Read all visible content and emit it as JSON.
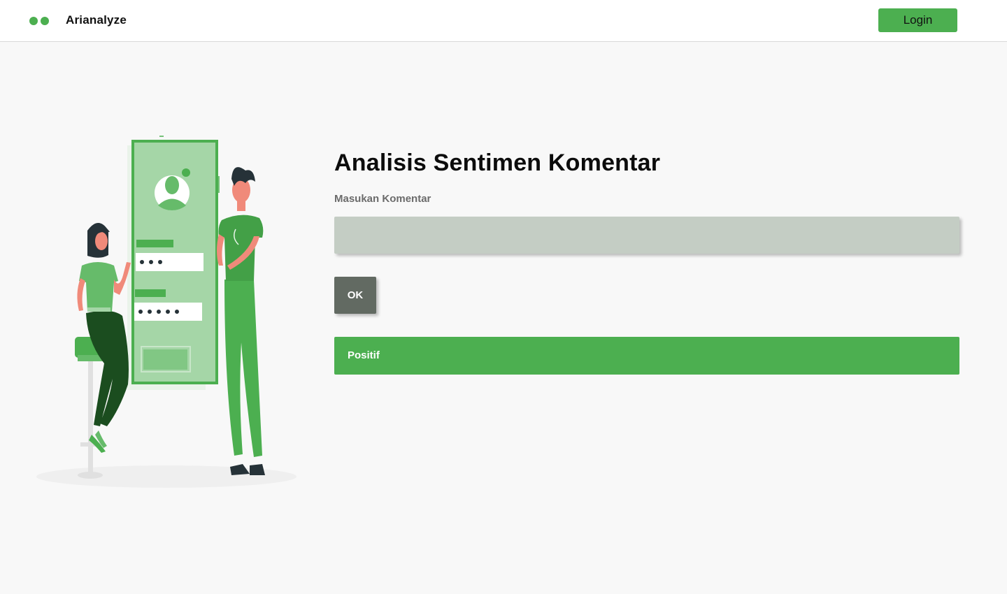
{
  "navbar": {
    "brand": "Arianalyze",
    "login_label": "Login",
    "logo_icon": "two-dots-logo-icon",
    "accent_color": "#4caf50"
  },
  "illustration": {
    "name": "people-with-login-screen-illustration"
  },
  "main": {
    "title": "Analisis Sentimen Komentar",
    "input_label": "Masukan Komentar",
    "input_value": "",
    "input_placeholder": "",
    "ok_label": "OK",
    "result_text": "Positif",
    "result_color": "#4caf50"
  }
}
